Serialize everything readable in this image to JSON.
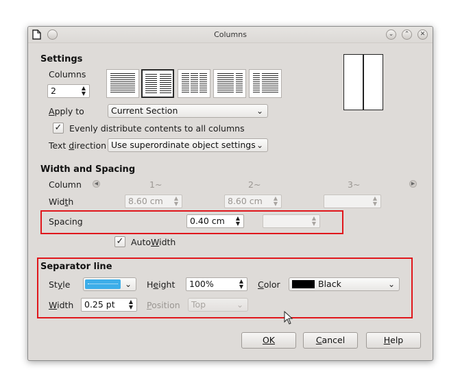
{
  "window": {
    "title": "Columns"
  },
  "settings": {
    "heading": "Settings",
    "columns_label": "Columns",
    "columns_value": "2",
    "apply_to_label": "Apply to",
    "apply_to_value": "Current Section",
    "evenly_label": "Evenly distribute contents to all columns",
    "evenly_checked": true,
    "text_direction_label": "Text direction",
    "text_direction_value": "Use superordinate object settings"
  },
  "width_spacing": {
    "heading": "Width and Spacing",
    "column_label": "Column",
    "col_headers": [
      "1~",
      "2~",
      "3~"
    ],
    "width_label": "Width",
    "widths": [
      "8.60 cm",
      "8.60 cm",
      ""
    ],
    "spacing_label": "Spacing",
    "spacing_value": "0.40 cm",
    "spacing_value2": "",
    "autowidth_label": "AutoWidth",
    "autowidth_checked": true
  },
  "separator": {
    "heading": "Separator line",
    "style_label": "Style",
    "height_label": "Height",
    "height_value": "100%",
    "color_label": "Color",
    "color_value": "Black",
    "color_swatch": "#000000",
    "width_label": "Width",
    "width_value": "0.25 pt",
    "position_label": "Position",
    "position_value": "Top"
  },
  "buttons": {
    "ok": "OK",
    "cancel": "Cancel",
    "help": "Help"
  },
  "colors": {
    "highlight": "#3daee9",
    "annotation_red": "#e0161b"
  }
}
